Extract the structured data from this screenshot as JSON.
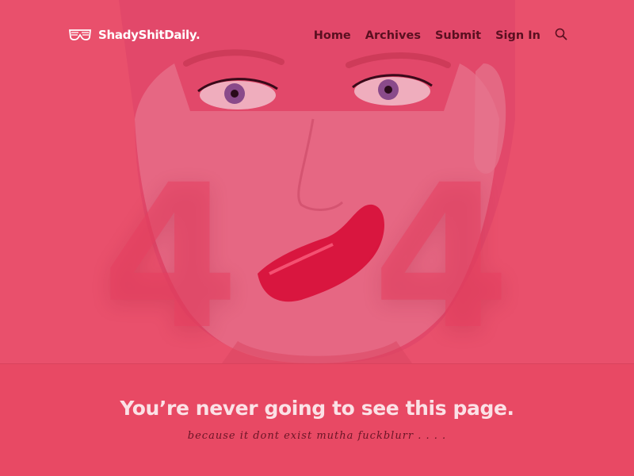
{
  "brand": {
    "name": "ShadyShitDaily.",
    "logo_icon": "shutter-shades-icon"
  },
  "nav": {
    "items": [
      {
        "label": "Home"
      },
      {
        "label": "Archives"
      },
      {
        "label": "Submit"
      },
      {
        "label": "Sign In"
      }
    ],
    "search_icon": "search-icon"
  },
  "error": {
    "code_digits": [
      "4",
      "0",
      "4"
    ]
  },
  "message": {
    "headline": "You’re never going to see this page.",
    "subline": "because it dont exist mutha fuckblurr . . . ."
  },
  "colors": {
    "background": "#e84964",
    "nav_text": "#5a0f20",
    "headline": "#fbe1e6"
  }
}
